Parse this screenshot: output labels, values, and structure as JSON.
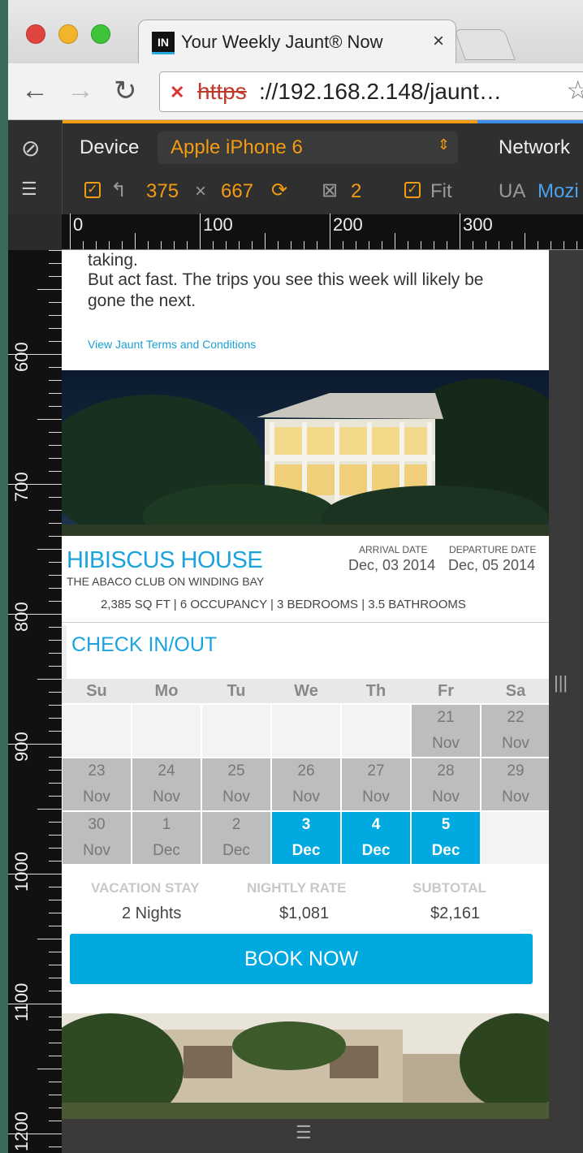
{
  "browser": {
    "tab_title": "Your Weekly Jaunt® Now",
    "tab_favicon": "IN",
    "tab_close": "×",
    "url_scheme": "https",
    "url_rest": "://192.168.2.148/jaunt…"
  },
  "device_bar": {
    "device_label": "Device",
    "device_value": "Apple iPhone 6",
    "network_label": "Network",
    "width": "375",
    "times": "×",
    "height": "667",
    "scale": "2",
    "fit_label": "Fit",
    "ua_label": "UA",
    "ua_value": "Mozi"
  },
  "ruler": {
    "top": [
      "0",
      "100",
      "200",
      "300"
    ],
    "left": [
      "600",
      "700",
      "800",
      "900",
      "1000",
      "1100",
      "1200"
    ]
  },
  "page": {
    "intro_line1": "taking.",
    "intro_line2": "But act fast. The trips you see this week will likely be",
    "intro_line3": "gone the next.",
    "terms_link": "View Jaunt Terms and Conditions",
    "property_title": "HIBISCUS HOUSE",
    "property_subtitle": "THE ABACO CLUB ON WINDING BAY",
    "arrival_label": "ARRIVAL DATE",
    "arrival_value": "Dec, 03 2014",
    "departure_label": "DEPARTURE DATE",
    "departure_value": "Dec, 05 2014",
    "specs": "2,385 SQ FT  |  6 OCCUPANCY  |  3 BEDROOMS  |  3.5 BATHROOMS",
    "checkin_heading": "CHECK IN/OUT",
    "calendar": {
      "days": [
        "Su",
        "Mo",
        "Tu",
        "We",
        "Th",
        "Fr",
        "Sa"
      ],
      "rows": [
        [
          null,
          null,
          null,
          null,
          null,
          {
            "d": "21",
            "m": "Nov",
            "s": "past"
          },
          {
            "d": "22",
            "m": "Nov",
            "s": "past"
          }
        ],
        [
          {
            "d": "23",
            "m": "Nov",
            "s": "past"
          },
          {
            "d": "24",
            "m": "Nov",
            "s": "past"
          },
          {
            "d": "25",
            "m": "Nov",
            "s": "past"
          },
          {
            "d": "26",
            "m": "Nov",
            "s": "past"
          },
          {
            "d": "27",
            "m": "Nov",
            "s": "past"
          },
          {
            "d": "28",
            "m": "Nov",
            "s": "past"
          },
          {
            "d": "29",
            "m": "Nov",
            "s": "past"
          }
        ],
        [
          {
            "d": "30",
            "m": "Nov",
            "s": "past"
          },
          {
            "d": "1",
            "m": "Dec",
            "s": "past"
          },
          {
            "d": "2",
            "m": "Dec",
            "s": "past"
          },
          {
            "d": "3",
            "m": "Dec",
            "s": "sel"
          },
          {
            "d": "4",
            "m": "Dec",
            "s": "sel"
          },
          {
            "d": "5",
            "m": "Dec",
            "s": "sel"
          },
          null
        ]
      ]
    },
    "summary": {
      "stay_label": "VACATION STAY",
      "stay_value": "2 Nights",
      "rate_label": "NIGHTLY RATE",
      "rate_value": "$1,081",
      "subtotal_label": "SUBTOTAL",
      "subtotal_value": "$2,161"
    },
    "book_button": "BOOK NOW"
  },
  "colors": {
    "accent": "#00a9e0",
    "devtools_orange": "#f39c12",
    "past_cell": "#bdbdbd"
  }
}
